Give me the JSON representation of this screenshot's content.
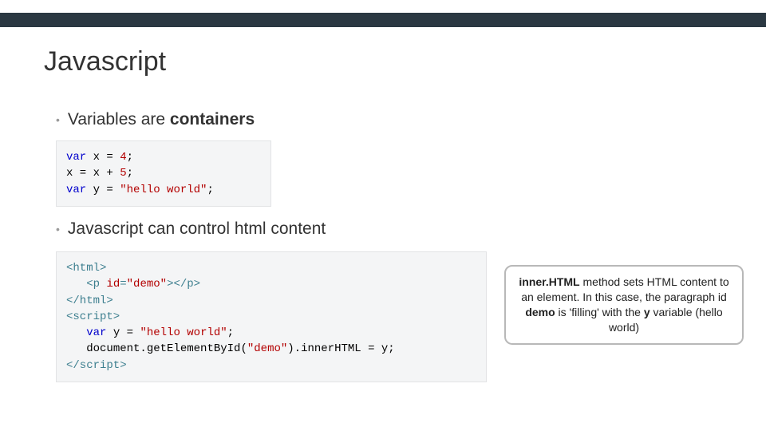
{
  "title": "Javascript",
  "bullets": {
    "b1_prefix": "Variables are ",
    "b1_bold": "containers",
    "b2": "Javascript can control html content"
  },
  "code1": {
    "l1a": "var",
    "l1b": " x = ",
    "l1c": "4",
    "l1d": ";",
    "l2a": "x = x + ",
    "l2b": "5",
    "l2c": ";",
    "l3a": "var",
    "l3b": " y = ",
    "l3c": "\"hello world\"",
    "l3d": ";"
  },
  "code2": {
    "l1": "<html>",
    "l2a": "   <p ",
    "l2b": "id",
    "l2c": "=",
    "l2d": "\"demo\"",
    "l2e": "></p>",
    "l3": "</html>",
    "l4": "<script>",
    "l5a": "   var",
    "l5b": " y = ",
    "l5c": "\"hello world\"",
    "l5d": ";",
    "l6a": "   document.getElementById(",
    "l6b": "\"demo\"",
    "l6c": ").innerHTML = y;",
    "l7": "</script>"
  },
  "callout": {
    "t1": "inner.HTML",
    "t2": " method sets HTML content to an element. In this case, the paragraph id ",
    "t3": "demo",
    "t4": " is 'filling' with the ",
    "t5": "y",
    "t6": " variable (hello world)"
  }
}
